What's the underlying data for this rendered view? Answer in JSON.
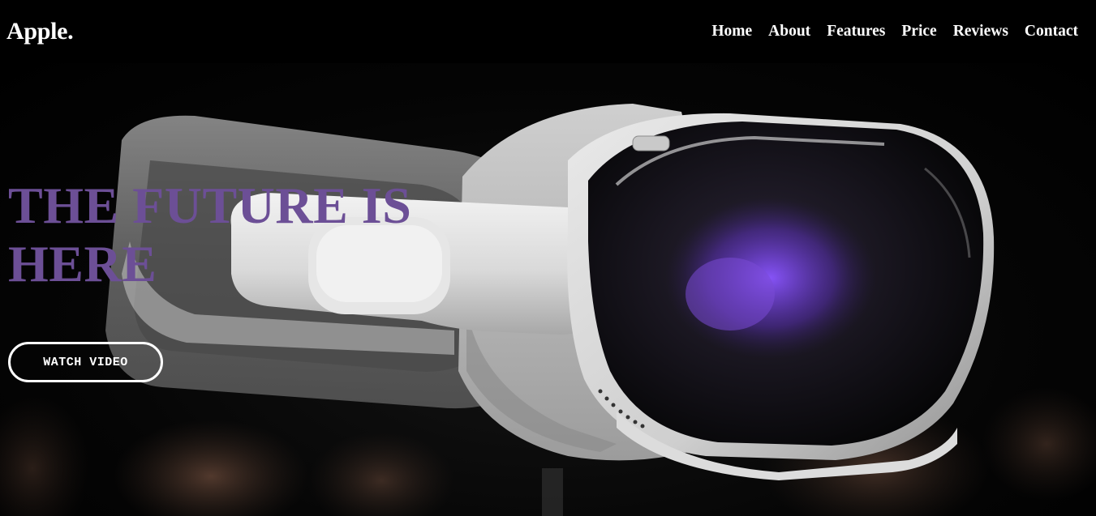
{
  "brand": {
    "logo_text": "Apple."
  },
  "nav": {
    "links": [
      {
        "label": "Home"
      },
      {
        "label": "About"
      },
      {
        "label": "Features"
      },
      {
        "label": "Price"
      },
      {
        "label": "Reviews"
      },
      {
        "label": "Contact"
      }
    ]
  },
  "hero": {
    "title": "THE FUTURE IS HERE",
    "button_label": "WATCH VIDEO",
    "image_subject": "vr-headset-photo"
  },
  "colors": {
    "nav_background": "#000000",
    "title_color": "#6c4f96",
    "button_border": "#ffffff",
    "text_white": "#ffffff"
  }
}
